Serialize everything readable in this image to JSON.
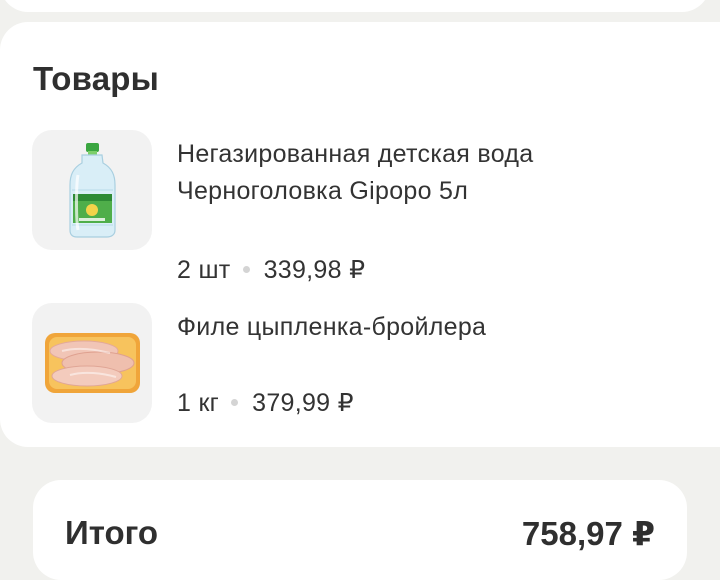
{
  "products_section": {
    "title": "Товары",
    "items": [
      {
        "name": "Негазированная детская вода Черноголовка Gipopo 5л",
        "quantity": "2 шт",
        "price": "339,98 ₽",
        "image_icon": "water-bottle-icon"
      },
      {
        "name": "Филе цыпленка-бройлера",
        "quantity": "1 кг",
        "price": "379,99 ₽",
        "image_icon": "chicken-fillet-icon"
      }
    ]
  },
  "summary": {
    "total_label": "Итого",
    "total_value": "758,97 ₽"
  },
  "colors": {
    "page_background": "#f1f1ee",
    "card_background": "#ffffff",
    "thumb_background": "#f2f2f2",
    "text_primary": "#333333",
    "separator_dot": "#d4d4d4"
  }
}
